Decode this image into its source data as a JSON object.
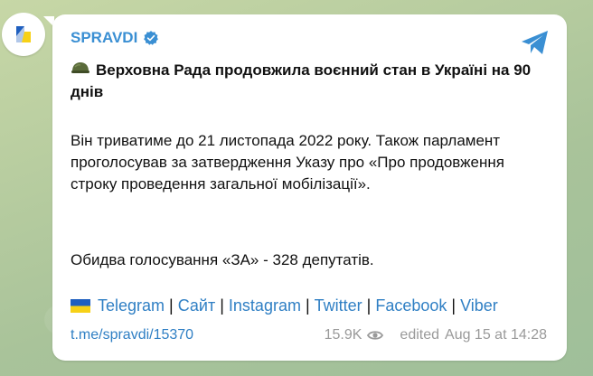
{
  "channel": {
    "name": "SPRAVDI"
  },
  "post": {
    "title": "Верховна Рада продовжила воєнний стан в Україні на 90 днів",
    "paragraph1": "Він триватиме до 21 листопада 2022 року. Також парламент проголосував за затвердження Указу про «Про продовження строку проведення загальної мобілізації».",
    "paragraph2": "Обидва голосування «ЗА» - 328 депутатів.",
    "links": [
      {
        "label": "Telegram"
      },
      {
        "label": "Сайт"
      },
      {
        "label": "Instagram"
      },
      {
        "label": "Twitter"
      },
      {
        "label": "Facebook"
      },
      {
        "label": "Viber"
      }
    ],
    "separator": "|",
    "post_link": "t.me/spravdi/15370",
    "views": "15.9K",
    "edited": "edited",
    "timestamp": "Aug 15 at 14:28"
  },
  "icons": {
    "avatar": "spravdi-logo-icon",
    "verified": "verified-badge-icon",
    "share": "share-arrow-icon",
    "helmet": "military-helmet-icon",
    "flag": "ukraine-flag-icon",
    "views": "eye-icon"
  },
  "colors": {
    "accent": "#3a8fd3",
    "link": "#2f7fc4",
    "bubble": "#ffffff",
    "meta": "#9a9a9a",
    "flag_blue": "#1f5fbf",
    "flag_yellow": "#f7d117"
  }
}
